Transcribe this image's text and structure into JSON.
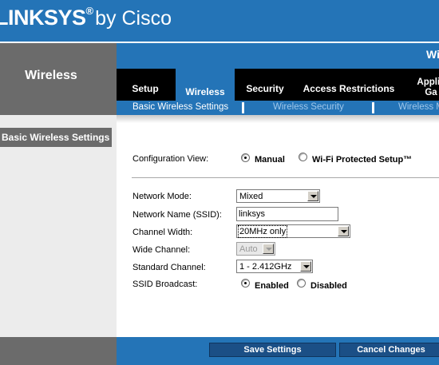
{
  "header": {
    "brand": "LINKSYS",
    "registered": "®",
    "by": "by Cisco",
    "product_name": "Wi"
  },
  "section": {
    "title": "Wireless"
  },
  "tabs": [
    {
      "label": "Setup"
    },
    {
      "label": "Wireless",
      "active": true
    },
    {
      "label": "Security"
    },
    {
      "label": "Access Restrictions"
    },
    {
      "label_line1": "Applic",
      "label_line2": "Ga"
    }
  ],
  "subtabs": [
    {
      "label": "Basic Wireless Settings",
      "active": true
    },
    {
      "label": "Wireless Security"
    },
    {
      "label": "Wireless M"
    }
  ],
  "sidebar": {
    "heading": "Basic Wireless Settings"
  },
  "config_view": {
    "label": "Configuration View:",
    "options": [
      {
        "label": "Manual",
        "checked": true
      },
      {
        "label": "Wi-Fi Protected Setup™",
        "checked": false
      }
    ]
  },
  "form": {
    "network_mode": {
      "label": "Network Mode:",
      "value": "Mixed"
    },
    "ssid": {
      "label": "Network Name (SSID):",
      "value": "linksys"
    },
    "channel_width": {
      "label": "Channel Width:",
      "value": "20MHz only"
    },
    "wide_channel": {
      "label": "Wide Channel:",
      "value": "Auto",
      "disabled": true
    },
    "standard_channel": {
      "label": "Standard Channel:",
      "value": "1 - 2.412GHz"
    },
    "ssid_broadcast": {
      "label": "SSID Broadcast:",
      "options": [
        {
          "label": "Enabled",
          "checked": true
        },
        {
          "label": "Disabled",
          "checked": false
        }
      ]
    }
  },
  "footer": {
    "save_label": "Save Settings",
    "cancel_label": "Cancel Changes"
  },
  "colors": {
    "brand_blue": "#2474b7",
    "panel_gray": "#6b6b6b",
    "tab_black": "#000000",
    "button_navy": "#1b4f86"
  }
}
